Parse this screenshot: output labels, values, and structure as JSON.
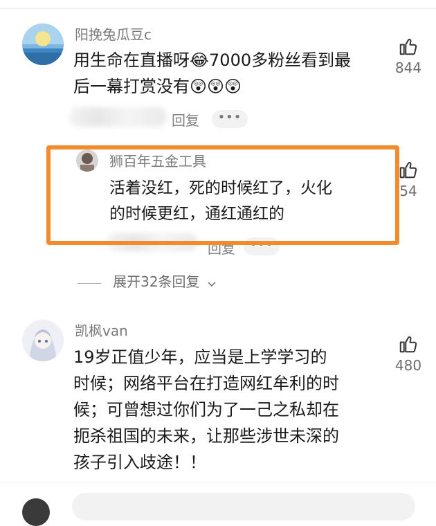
{
  "comments": [
    {
      "username": "阳挽兔瓜豆c",
      "text_line1": "用生命在直播呀😂7000多粉丝看到最",
      "text_line2": "后一幕打赏没有😲😲😲",
      "reply_label": "回复",
      "more_label": "•••",
      "likes": "844"
    },
    {
      "username": "凯枫van",
      "text_lines": [
        "19岁正值少年，应当是上学学习的",
        "时候；网络平台在打造网红牟利的时",
        "候；可曾想过你们为了一己之私却在",
        "扼杀祖国的未来，让那些涉世未深的",
        "孩子引入歧途！！"
      ],
      "likes": "480"
    }
  ],
  "reply": {
    "username": "狮百年五金工具",
    "text_line1": "活着没红，死的时候红了，火化",
    "text_line2": "的时候更红，通红通红的",
    "reply_label": "回复",
    "more_label": "•••",
    "likes": "54"
  },
  "expand_label": "展开32条回复",
  "colors": {
    "highlight": "#f28a2e",
    "text": "#1a1a1a",
    "meta": "#7b7b7b"
  }
}
